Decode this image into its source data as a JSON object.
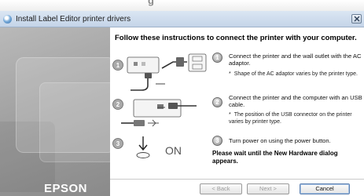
{
  "window": {
    "background_heading_fragment": "g",
    "title": "Install Label Editor printer drivers"
  },
  "sidebar": {
    "brand": "EPSON"
  },
  "content": {
    "heading": "Follow these instructions to connect the printer with your computer.",
    "illustration": {
      "on_label": "ON"
    },
    "steps": [
      {
        "number": "1",
        "text": "Connect the printer and the wall outlet with the AC adaptor.",
        "note": "Shape of the AC adaptor varies by the printer type."
      },
      {
        "number": "2",
        "text": "Connect the printer and the computer with an USB cable.",
        "note": "The position of the USB connector on the printer varies by printer type."
      },
      {
        "number": "3",
        "text": "Turn power on using the power button.",
        "note": ""
      }
    ],
    "wait_message": "Please wait until the New Hardware dialog appears."
  },
  "footer": {
    "back_label": "< Back",
    "next_label": "Next >",
    "cancel_label": "Cancel"
  }
}
